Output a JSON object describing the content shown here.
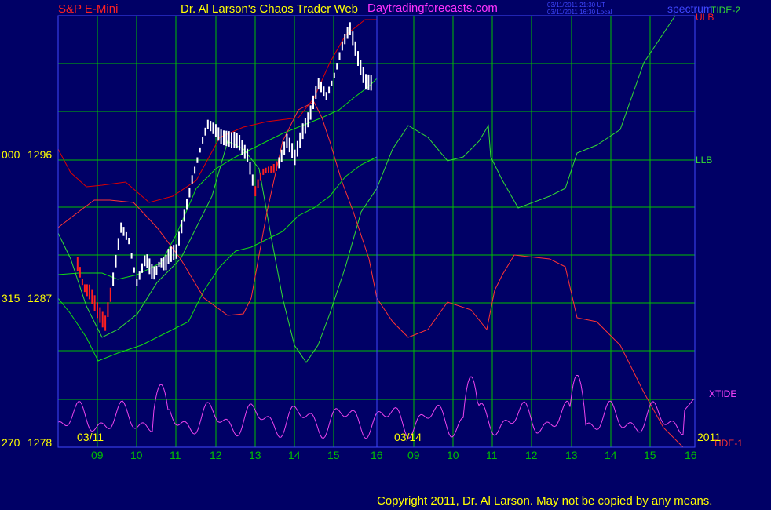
{
  "header": {
    "instrument": "S&P E-Mini",
    "title": "Dr. Al Larson's Chaos Trader Web",
    "site": "Daytradingforecasts.com",
    "stamp_ut": "03/11/2011 21:30 UT",
    "stamp_local": "03/11/2011 16:30 Local",
    "spectrum": "spectrum"
  },
  "yaxis": {
    "labels": [
      {
        "code": "000",
        "value": "1296"
      },
      {
        "code": "315",
        "value": "1287"
      },
      {
        "code": "270",
        "value": "1278"
      }
    ]
  },
  "dates": {
    "left": "03/11",
    "right": "03/14",
    "year": "2011"
  },
  "legend": {
    "ulb": "ULB",
    "tide2": "TIDE-2",
    "llb": "LLB",
    "xtide": "XTIDE",
    "tide1": "TIDE-1"
  },
  "colors": {
    "background": "#000066",
    "grid": "#00c000",
    "frame": "#3f47ff",
    "price_up": "#ffffff",
    "price_down": "#ff2020",
    "ulb": "#dd0000",
    "llb": "#11dd11",
    "xtide": "#ee44ee",
    "tide1": "#ff3333",
    "tide2": "#33dd33",
    "magenta": "#ff33ff",
    "yellow": "#ffff00",
    "red": "#ff2020"
  },
  "footer": {
    "copyright": "Copyright 2011, Dr. Al Larson. May not be copied by any means."
  },
  "chart_data": {
    "type": "line",
    "title": "S&P E-Mini",
    "x_tick_labels": [
      "09",
      "10",
      "11",
      "12",
      "13",
      "14",
      "15",
      "16",
      "09",
      "10",
      "11",
      "12",
      "13",
      "14",
      "15",
      "16"
    ],
    "ylim": [
      1278,
      1305
    ],
    "y_labels": [
      1296,
      1287,
      1278
    ],
    "grid": true,
    "price_03_11_approx": {
      "x_hours": [
        8.5,
        8.8,
        9.0,
        9.2,
        9.4,
        9.6,
        9.8,
        10.0,
        10.2,
        10.5,
        10.8,
        11.0,
        11.2,
        11.4,
        11.6,
        11.8,
        12.0,
        12.2,
        12.4,
        12.6,
        12.8,
        13.0,
        13.2,
        13.4,
        13.6,
        13.8,
        14.0,
        14.2,
        14.4,
        14.6,
        14.8,
        15.0,
        15.2,
        15.4,
        15.6,
        15.8,
        16.0
      ],
      "y": [
        1289.2,
        1287.5,
        1286.5,
        1286.0,
        1288.5,
        1291.5,
        1291.0,
        1288.5,
        1289.5,
        1289.0,
        1290.0,
        1290.0,
        1292.5,
        1295.0,
        1296.5,
        1298.0,
        1298.0,
        1297.5,
        1297.0,
        1297.0,
        1296.5,
        1294.0,
        1295.0,
        1295.5,
        1296.0,
        1297.0,
        1296.0,
        1298.0,
        1299.0,
        1300.5,
        1300.0,
        1301.5,
        1303.0,
        1304.0,
        1302.5,
        1301.0,
        1300.5
      ]
    },
    "series": [
      {
        "name": "ULB"
      },
      {
        "name": "LLB"
      },
      {
        "name": "XTIDE"
      },
      {
        "name": "TIDE-1"
      },
      {
        "name": "TIDE-2"
      }
    ]
  }
}
